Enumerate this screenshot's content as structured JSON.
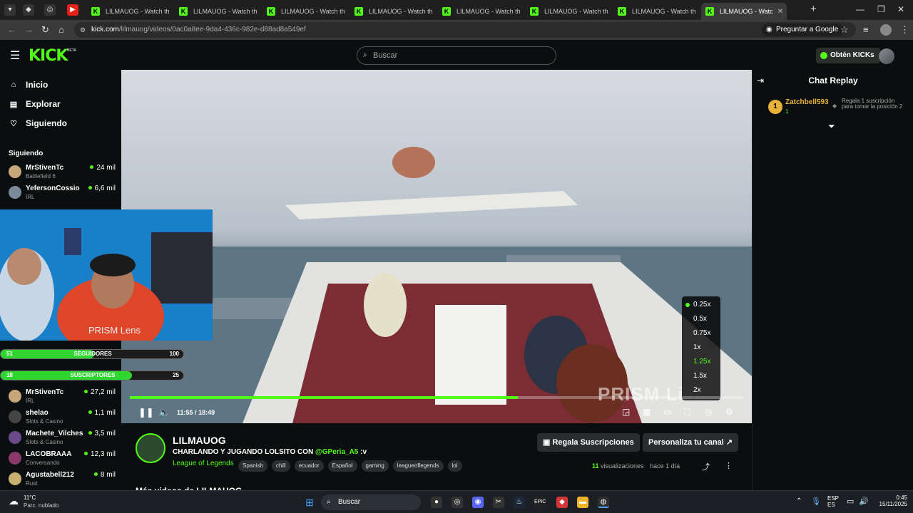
{
  "browser": {
    "pinned_tabs": [
      "chevron-down-icon",
      "pocket-icon",
      "extension-icon",
      "youtube-icon"
    ],
    "tabs": [
      {
        "label": "LILMAUOG - Watch th",
        "active": false
      },
      {
        "label": "LILMAUOG - Watch th",
        "active": false
      },
      {
        "label": "LILMAUOG - Watch th",
        "active": false
      },
      {
        "label": "LILMAUOG - Watch th",
        "active": false
      },
      {
        "label": "LILMAUOG - Watch th",
        "active": false
      },
      {
        "label": "LILMAUOG - Watch th",
        "active": false
      },
      {
        "label": "LILMAUOG - Watch th",
        "active": false
      },
      {
        "label": "LILMAUOG - Watc",
        "active": true
      }
    ],
    "favicon": "K",
    "close_glyph": "✕",
    "new_tab": "+",
    "url_host": "kick.com",
    "url_path": "/lilmauog/videos/0ac0a8ee-9da4-436c-982e-d88ad8a549ef",
    "ask_google": "Preguntar a Google"
  },
  "kick": {
    "logo": "KICK",
    "beta": "BETA",
    "search_placeholder": "Buscar",
    "kicks_button": "Obtén KICKs"
  },
  "sidebar": {
    "nav": [
      {
        "label": "Inicio",
        "icon": "home-icon"
      },
      {
        "label": "Explorar",
        "icon": "browse-icon"
      },
      {
        "label": "Siguiendo",
        "icon": "heart-icon"
      }
    ],
    "following_title": "Siguiendo",
    "streamers_top": [
      {
        "name": "MrStivenTc",
        "category": "Battlefield 6",
        "viewers": "24 mil",
        "color": "#c9a67a"
      },
      {
        "name": "YefersonCossio",
        "category": "IRL",
        "viewers": "6,6 mil",
        "color": "#7a8a9a"
      }
    ],
    "streamers_bottom": [
      {
        "name": "MrStivenTc",
        "category": "IRL",
        "viewers": "27,2 mil",
        "color": "#c9a67a"
      },
      {
        "name": "shelao",
        "category": "Slots & Casino",
        "viewers": "1,1 mil",
        "color": "#444"
      },
      {
        "name": "Machete_Vilches",
        "category": "Slots & Casino",
        "viewers": "3,5 mil",
        "color": "#6a4a8a"
      },
      {
        "name": "LACOBRAAA",
        "category": "Conversando",
        "viewers": "12,3 mil",
        "color": "#8a3a6a"
      },
      {
        "name": "Agustabell212",
        "category": "Rust",
        "viewers": "8 mil",
        "color": "#c8b070"
      }
    ]
  },
  "webcam": {
    "lens_label": "PRISM Lens",
    "followers": {
      "current": "51",
      "label": "SEGUIDORES",
      "goal": "100",
      "progress": 0.51
    },
    "subs": {
      "current": "18",
      "label": "SUSCRIPTORES",
      "goal": "25",
      "progress": 0.72
    }
  },
  "player": {
    "time_current": "11:55",
    "time_total": "18:49",
    "time_separator": "/",
    "progress": 0.633,
    "speeds": [
      "0.25x",
      "0.5x",
      "0.75x",
      "1x",
      "1.25x",
      "1.5x",
      "2x"
    ],
    "selected_speed": "0.25x",
    "hovered_speed": "1.25x",
    "watermark": "PRISM Live"
  },
  "chat": {
    "title": "Chat Replay",
    "entry": {
      "rank": "1",
      "user": "Zatchbell593",
      "count": "1",
      "message": "Regala 1 suscripción para tomar la posición 2"
    }
  },
  "channel": {
    "name": "LILMAUOG",
    "title_prefix": "CHARLANDO Y JUGANDO LOLSITO CON ",
    "title_mention": "@GPeria_A5",
    "title_suffix": " :v",
    "category": "League of Legends",
    "tags": [
      "Spanish",
      "chill",
      "ecuador",
      "Español",
      "gaming",
      "leagueoflegends",
      "lol"
    ],
    "gift_button": "Regala Suscripciones",
    "customize_button": "Personaliza tu canal",
    "views_count": "11",
    "views_label": "visualizaciones",
    "age": "hace 1 día",
    "more_videos": "Más videos de LILMAUOG"
  },
  "taskbar": {
    "weather_temp": "11°C",
    "weather_desc": "Parc. nublado",
    "search_label": "Buscar",
    "lang_top": "ESP",
    "lang_bottom": "ES",
    "time": "0:45",
    "date": "15/11/2025"
  }
}
